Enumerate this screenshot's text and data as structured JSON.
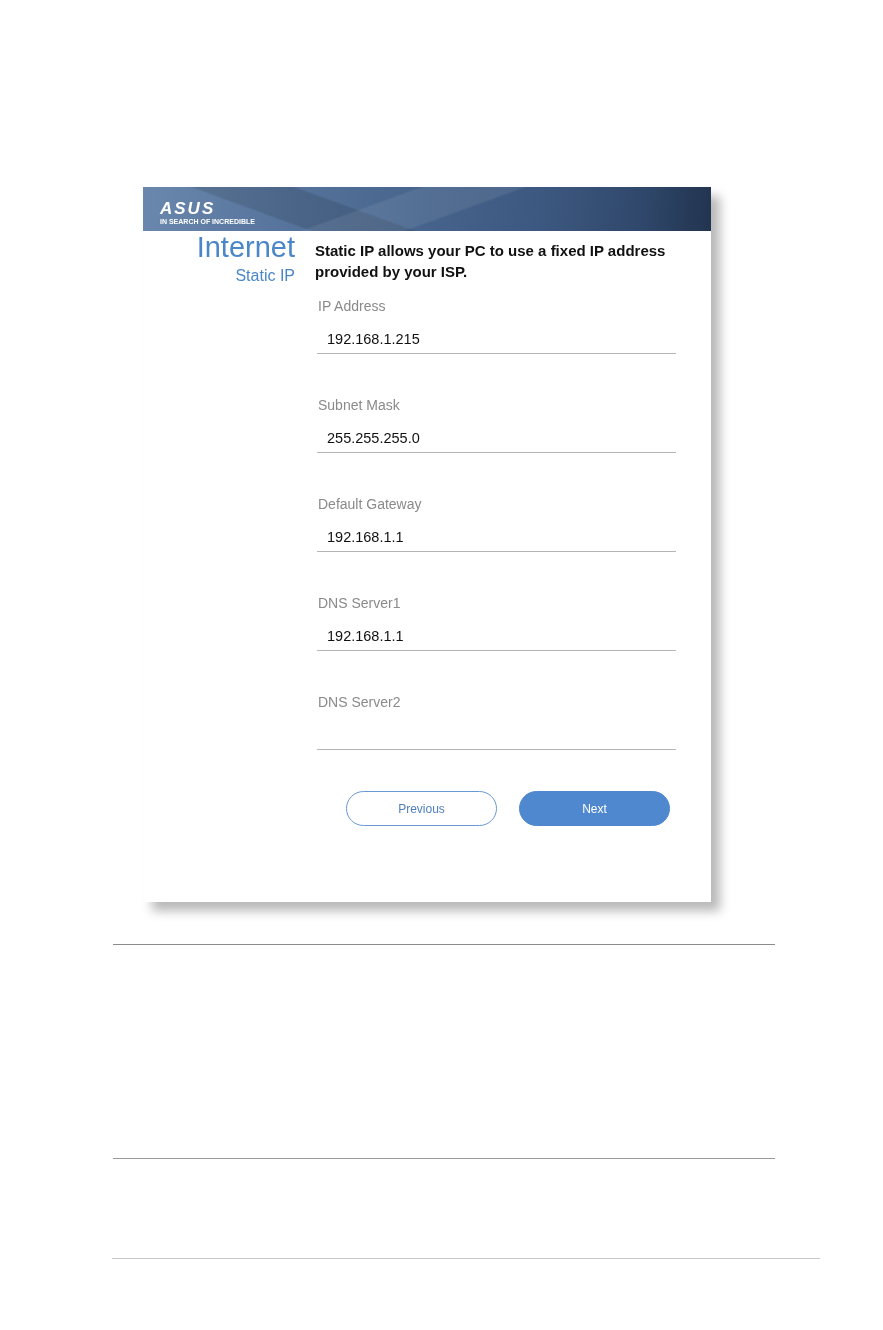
{
  "header": {
    "logo": {
      "wordmark": "ASUS",
      "tagline": "IN SEARCH OF INCREDIBLE"
    }
  },
  "sidebar": {
    "title": "Internet",
    "subtitle": "Static IP"
  },
  "form": {
    "description": "Static IP allows your PC to use a fixed IP address provided by your ISP.",
    "fields": [
      {
        "label": "IP Address",
        "value": "192.168.1.215"
      },
      {
        "label": "Subnet Mask",
        "value": "255.255.255.0"
      },
      {
        "label": "Default Gateway",
        "value": "192.168.1.1"
      },
      {
        "label": "DNS Server1",
        "value": "192.168.1.1"
      },
      {
        "label": "DNS Server2"
      }
    ]
  },
  "buttons": [
    {
      "label": "Previous",
      "kind": "secondary"
    },
    {
      "label": "Next",
      "kind": "primary"
    }
  ]
}
